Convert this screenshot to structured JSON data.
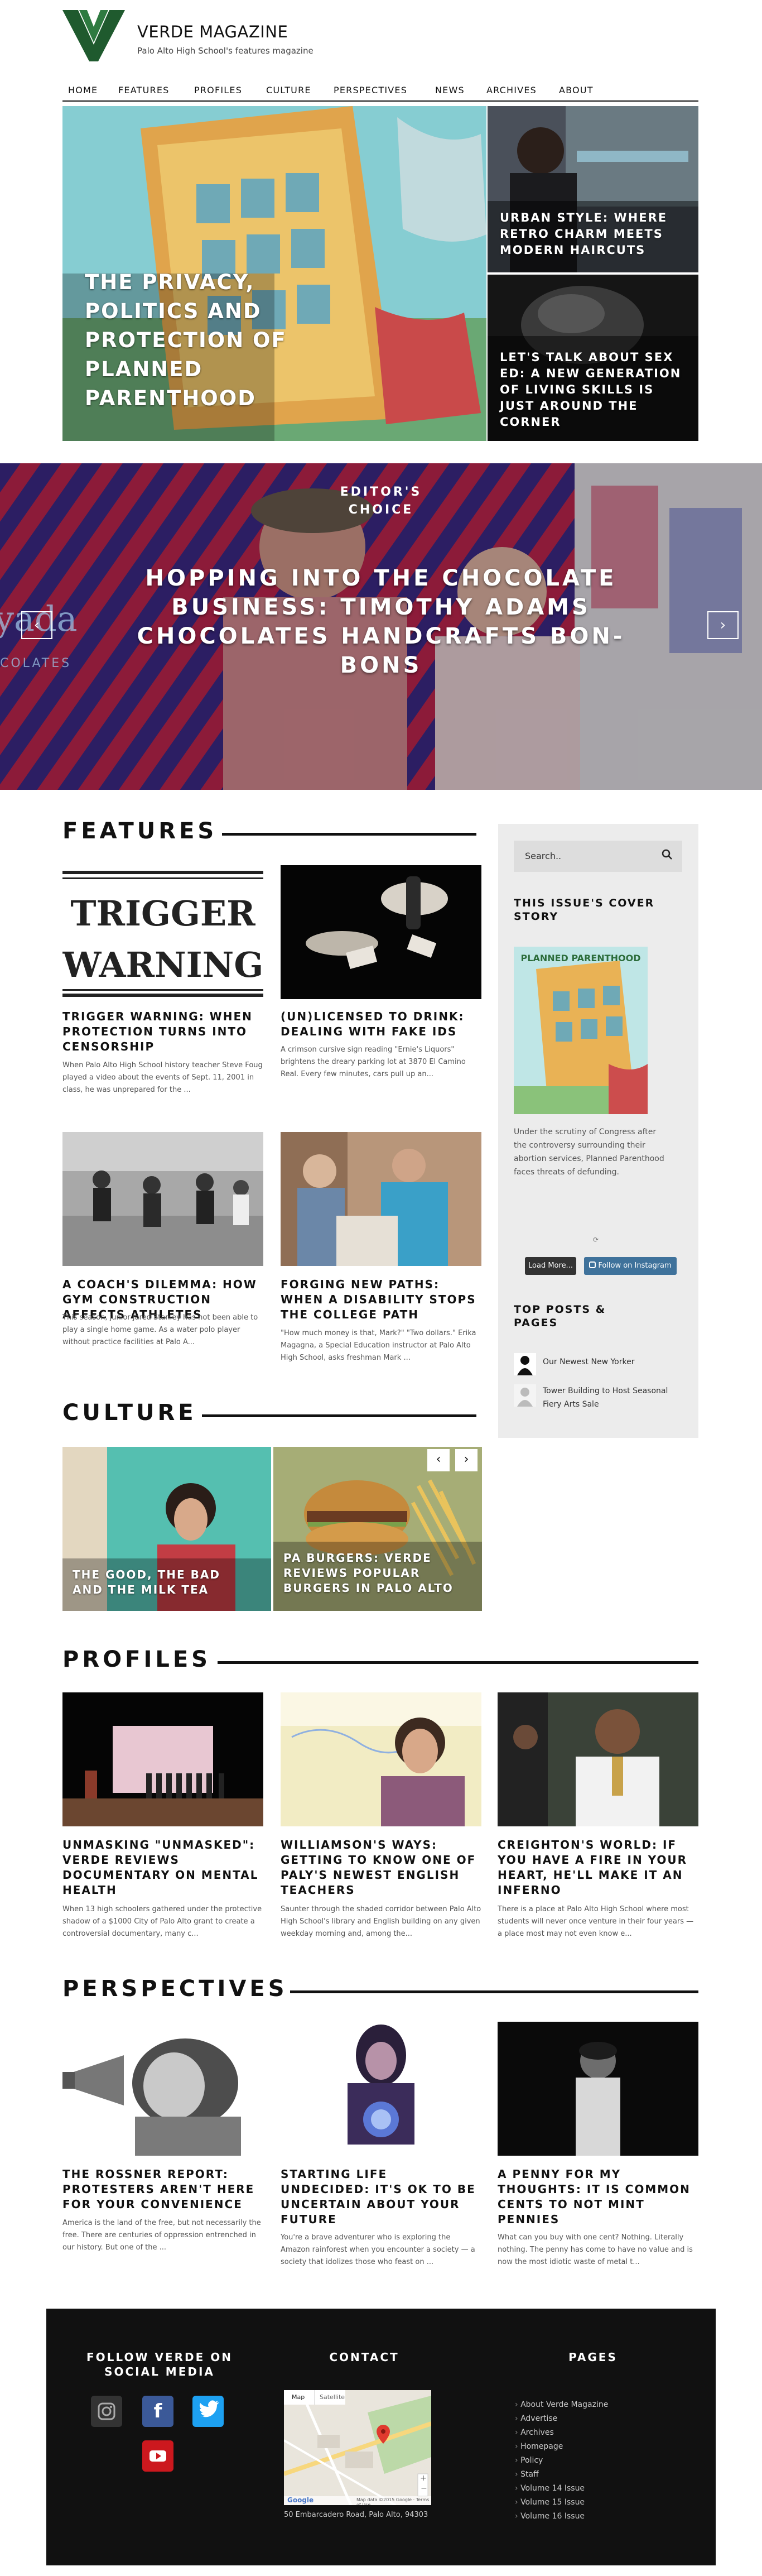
{
  "header": {
    "brand": "VERDE MAGAZINE",
    "tagline": "Palo Alto High School's features magazine",
    "nav": [
      "HOME",
      "FEATURES",
      "PROFILES",
      "CULTURE",
      "PERSPECTIVES",
      "NEWS",
      "ARCHIVES",
      "ABOUT"
    ]
  },
  "hero": {
    "main": "THE PRIVACY, POLITICS AND PROTECTION OF PLANNED PARENTHOOD",
    "top_right": "URBAN STYLE: WHERE RETRO CHARM MEETS MODERN HAIRCUTS",
    "bottom_right": "LET'S TALK ABOUT SEX ED: A NEW GENERATION OF LIVING SKILLS IS JUST AROUND THE CORNER"
  },
  "slider": {
    "label": "EDITOR'S CHOICE",
    "title": "HOPPING INTO THE CHOCOLATE BUSINESS: TIMOTHY ADAMS CHOCOLATES HANDCRAFTS BON-BONS",
    "prev": "‹",
    "next": "›"
  },
  "features": {
    "heading": "FEATURES",
    "cards": [
      {
        "title": "TRIGGER WARNING: WHEN PROTECTION TURNS INTO CENSORSHIP",
        "excerpt": "When Palo Alto High School history teacher Steve Foug played a video about the events of Sept. 11, 2001 in class, he was unprepared for the ...",
        "img_text": "TRIGGER WARNING"
      },
      {
        "title": "(UN)LICENSED TO DRINK: DEALING WITH FAKE IDS",
        "excerpt": "A crimson cursive sign reading \"Ernie's Liquors\" brightens the dreary parking lot at 3870 El Camino Real. Every few minutes, cars pull up an..."
      },
      {
        "title": "A COACH'S DILEMMA: HOW GYM CONSTRUCTION AFFECTS ATHLETES",
        "excerpt": "This season, junior Jared Stanley has not been able to play a single home game. As a water polo player without practice facilities at Palo A..."
      },
      {
        "title": "FORGING NEW PATHS: WHEN A DISABILITY STOPS THE COLLEGE PATH",
        "excerpt": "\"How much money is that, Mark?\" \"Two dollars.\" Erika Magagna, a Special Education instructor at Palo Alto High School, asks freshman Mark ..."
      }
    ]
  },
  "sidebar": {
    "search_placeholder": "Search..",
    "cover_heading": "THIS ISSUE'S COVER STORY",
    "cover_text": "Under the scrutiny of Congress after the controversy surrounding their abortion services, Planned Parenthood faces threats of defunding.",
    "cover_art_text": "PLANNED PARENTHOOD",
    "load_more": "Load More...",
    "follow": "Follow on Instagram",
    "top_heading": "TOP POSTS & PAGES",
    "top_posts": [
      "Our Newest New Yorker",
      "Tower Building to Host Seasonal Fiery Arts Sale"
    ]
  },
  "culture": {
    "heading": "CULTURE",
    "items": [
      "THE GOOD, THE BAD AND THE MILK TEA",
      "PA BURGERS: VERDE REVIEWS POPULAR BURGERS IN PALO ALTO"
    ],
    "prev": "‹",
    "next": "›"
  },
  "profiles": {
    "heading": "PROFILES",
    "cards": [
      {
        "title": "UNMASKING \"UNMASKED\": VERDE REVIEWS DOCUMENTARY ON MENTAL HEALTH",
        "excerpt": "When 13 high schoolers gathered under the protective shadow of a $1000 City of Palo Alto grant to create a controversial documentary, many c..."
      },
      {
        "title": "WILLIAMSON'S WAYS: GETTING TO KNOW ONE OF PALY'S NEWEST ENGLISH TEACHERS",
        "excerpt": "Saunter through the shaded corridor between Palo Alto High School's library and English building on any given weekday morning and, among the..."
      },
      {
        "title": "CREIGHTON'S WORLD: IF YOU HAVE A FIRE IN YOUR HEART, HE'LL MAKE IT AN INFERNO",
        "excerpt": "There is a place at Palo Alto High School where most students will never once venture in their four years — a place most may not even know e..."
      }
    ]
  },
  "perspectives": {
    "heading": "PERSPECTIVES",
    "cards": [
      {
        "title": "THE ROSSNER REPORT: PROTESTERS AREN'T HERE FOR YOUR CONVENIENCE",
        "excerpt": "America is the land of the free, but not necessarily the free. There are centuries of oppression entrenched in our history. But one of the ..."
      },
      {
        "title": "STARTING LIFE UNDECIDED: IT'S OK TO BE UNCERTAIN ABOUT YOUR FUTURE",
        "excerpt": "You're a brave adventurer who is exploring the Amazon rainforest when you encounter a society — a society that idolizes those who feast on ..."
      },
      {
        "title": "A PENNY FOR MY THOUGHTS: IT IS COMMON CENTS TO NOT MINT PENNIES",
        "excerpt": "What can you buy with one cent? Nothing. Literally nothing. The penny has come to have no value and is now the most idiotic waste of metal t..."
      }
    ]
  },
  "footer": {
    "social_heading": "FOLLOW VERDE ON SOCIAL MEDIA",
    "contact_heading": "CONTACT",
    "pages_heading": "PAGES",
    "address": "50 Embarcadero Road, Palo Alto, 94303",
    "map_tabs": [
      "Map",
      "Satellite"
    ],
    "map_credit": "Google",
    "map_terms": "Map data ©2015 Google · Terms of Use",
    "pages": [
      "About Verde Magazine",
      "Advertise",
      "Archives",
      "Homepage",
      "Policy",
      "Staff",
      "Volume 14 Issue",
      "Volume 15 Issue",
      "Volume 16 Issue"
    ]
  },
  "colors": {
    "brand_green": "#1f5a2e",
    "black": "#111111",
    "facebook": "#3b5998",
    "twitter": "#1da1f2",
    "youtube": "#cc181e",
    "instagram_btn": "#3f729b"
  },
  "icons": [
    "search-icon",
    "instagram-icon",
    "facebook-icon",
    "twitter-icon",
    "youtube-icon",
    "map-pin-icon"
  ]
}
